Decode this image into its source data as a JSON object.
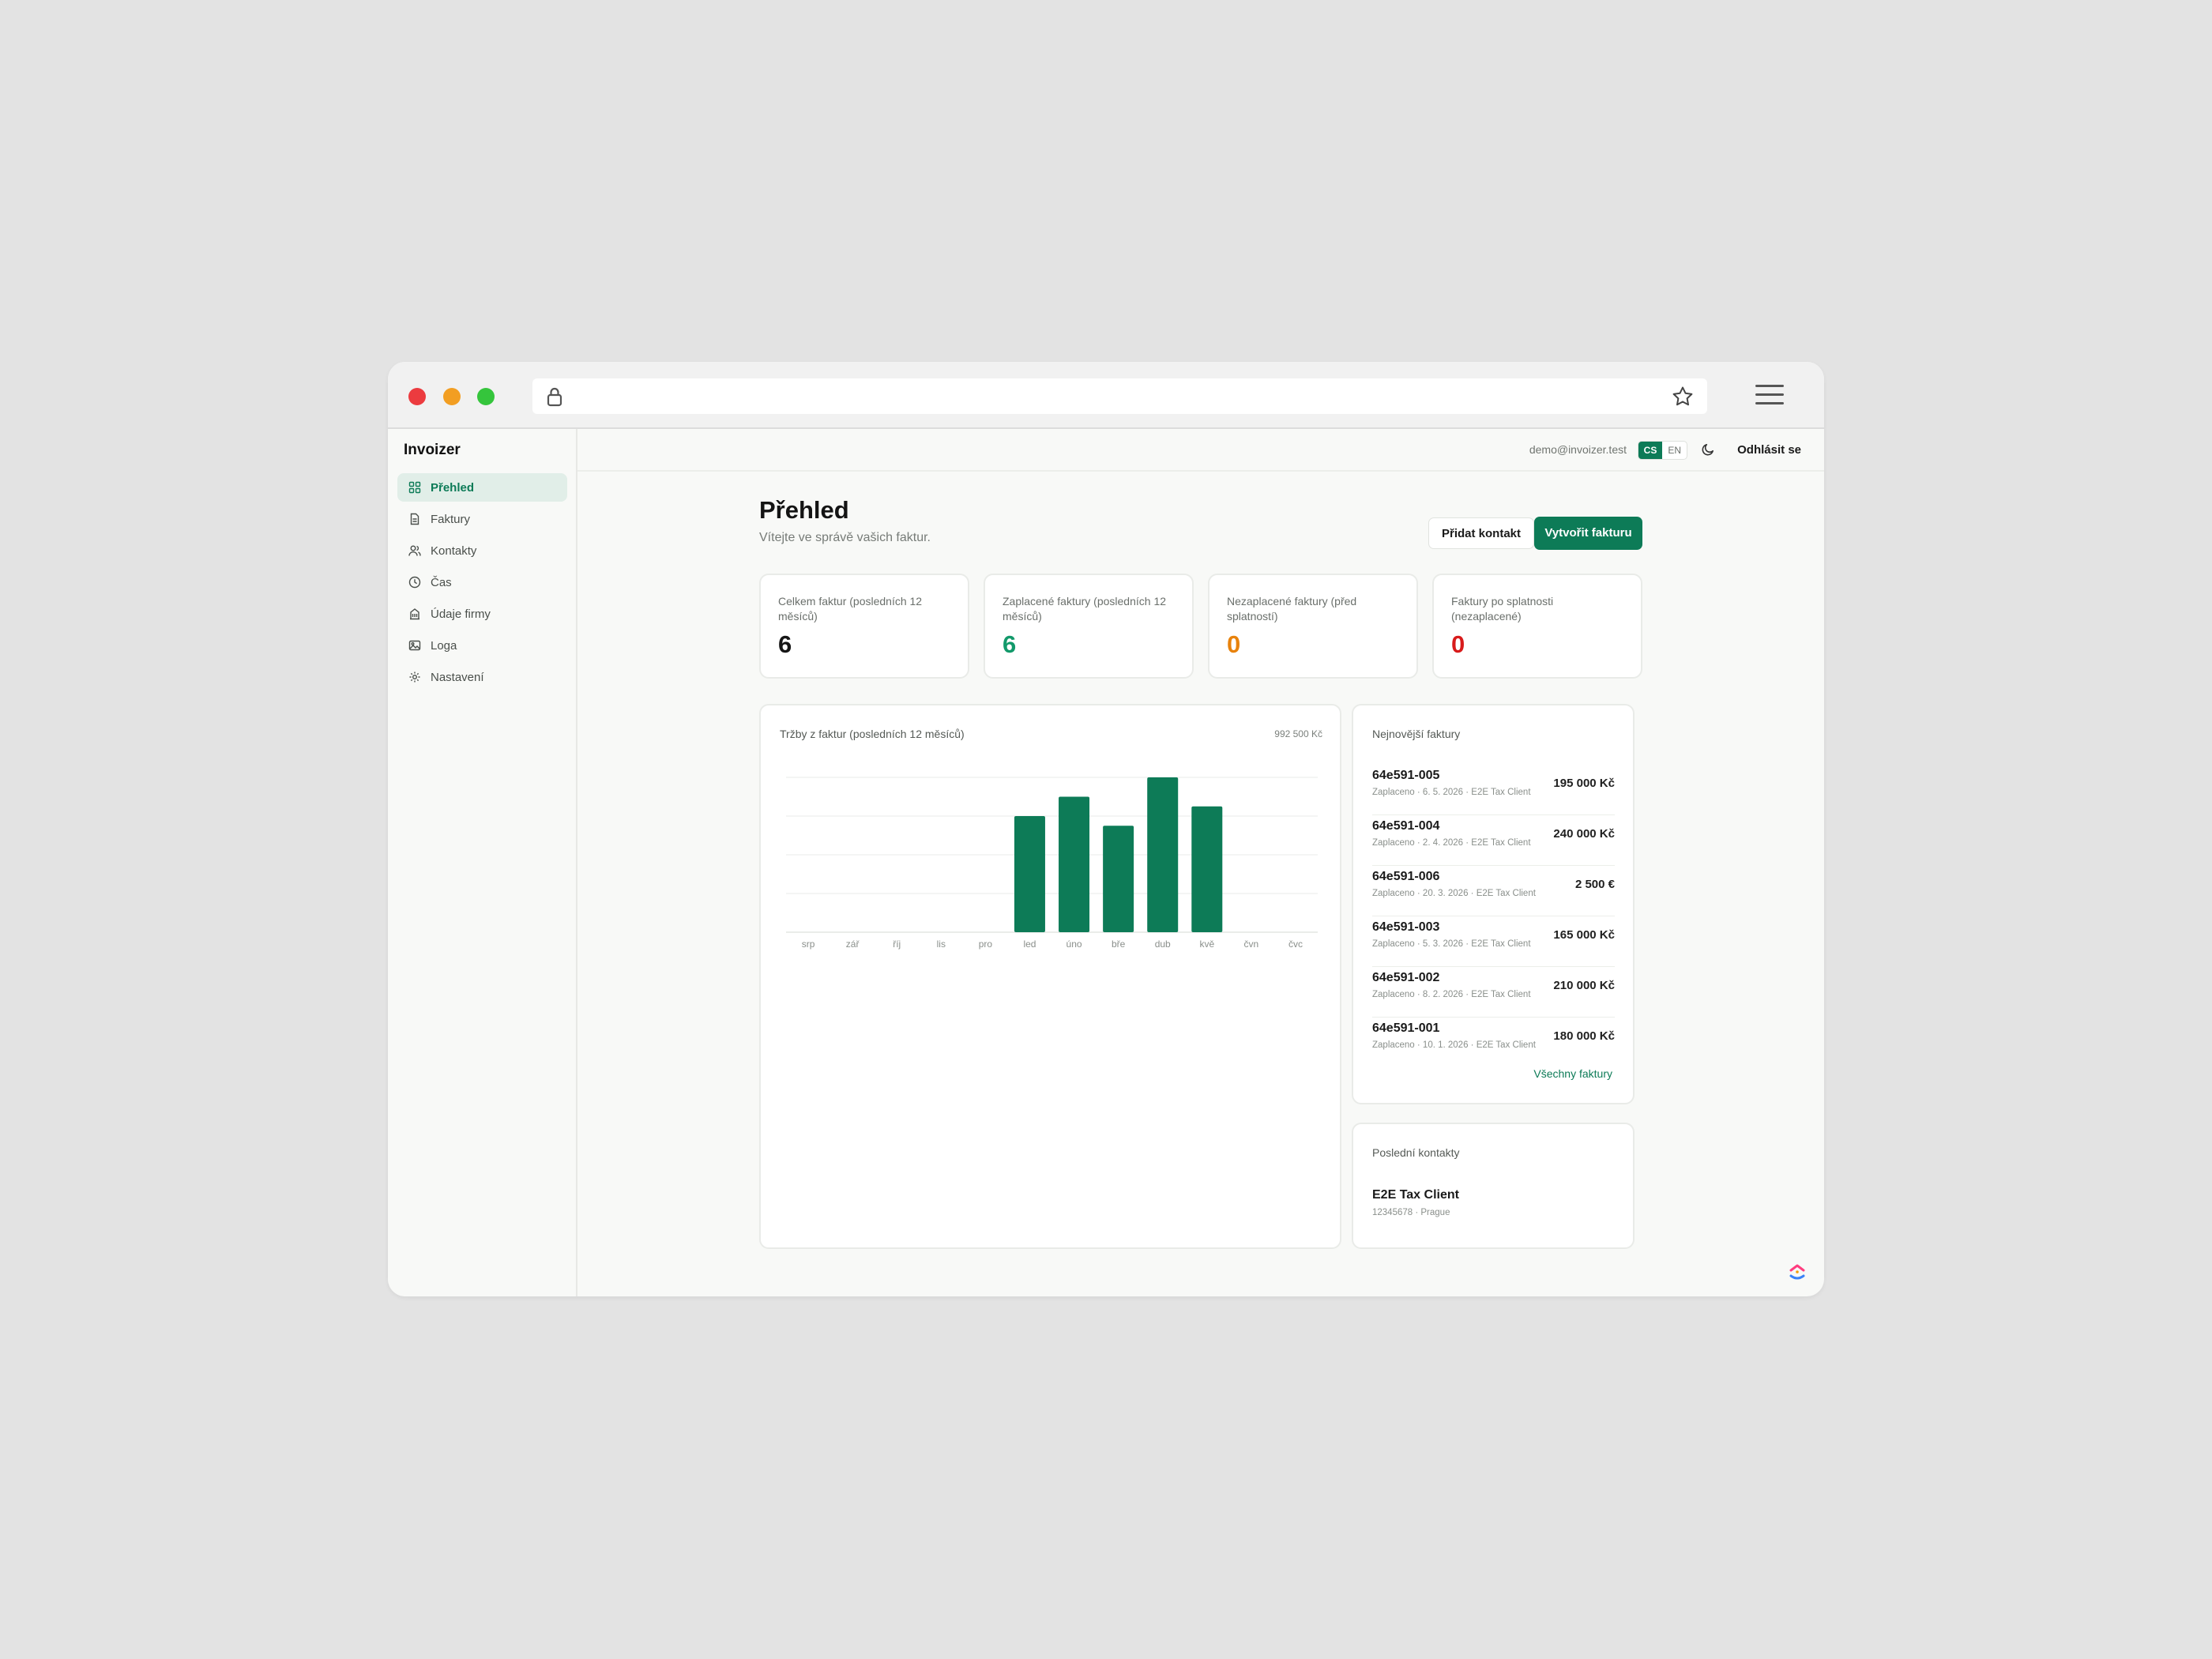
{
  "app": {
    "name": "Invoizer"
  },
  "colors": {
    "accent": "#0d7b57",
    "paid": "#12996a",
    "unpaid": "#e8820c",
    "overdue": "#d81b1b"
  },
  "sidebar": {
    "items": [
      {
        "label": "Přehled",
        "icon": "dashboard-icon",
        "active": true
      },
      {
        "label": "Faktury",
        "icon": "document-icon"
      },
      {
        "label": "Kontakty",
        "icon": "users-icon"
      },
      {
        "label": "Čas",
        "icon": "clock-icon"
      },
      {
        "label": "Údaje firmy",
        "icon": "building-icon"
      },
      {
        "label": "Loga",
        "icon": "image-icon"
      },
      {
        "label": "Nastavení",
        "icon": "gear-icon"
      }
    ]
  },
  "topbar": {
    "email": "demo@invoizer.test",
    "lang_cs": "CS",
    "lang_en": "EN",
    "logout_label": "Odhlásit se"
  },
  "page": {
    "title": "Přehled",
    "subtitle": "Vítejte ve správě vašich faktur.",
    "add_contact_label": "Přidat kontakt",
    "create_invoice_label": "Vytvořit fakturu"
  },
  "stats": [
    {
      "label": "Celkem faktur (posledních 12 měsíců)",
      "value": "6"
    },
    {
      "label": "Zaplacené faktury (posledních 12 měsíců)",
      "value": "6"
    },
    {
      "label": "Nezaplacené faktury (před splatností)",
      "value": "0"
    },
    {
      "label": "Faktury po splatnosti (nezaplacené)",
      "value": "0"
    }
  ],
  "chart_data": {
    "type": "bar",
    "title": "Tržby z faktur (posledních 12 měsíců)",
    "total_label": "992 500 Kč",
    "categories": [
      "srp",
      "zář",
      "říj",
      "lis",
      "pro",
      "led",
      "úno",
      "bře",
      "dub",
      "kvě",
      "čvn",
      "čvc"
    ],
    "values": [
      0,
      0,
      0,
      0,
      0,
      180000,
      210000,
      165000,
      240000,
      195000,
      0,
      0
    ],
    "ylim": [
      0,
      240000
    ],
    "grid": true
  },
  "recent_invoices": {
    "title": "Nejnovější faktury",
    "items": [
      {
        "number": "64e591-005",
        "meta": "Zaplaceno · 6. 5. 2026 · E2E Tax Client",
        "amount": "195 000 Kč"
      },
      {
        "number": "64e591-004",
        "meta": "Zaplaceno · 2. 4. 2026 · E2E Tax Client",
        "amount": "240 000 Kč"
      },
      {
        "number": "64e591-006",
        "meta": "Zaplaceno · 20. 3. 2026 · E2E Tax Client",
        "amount": "2 500 €"
      },
      {
        "number": "64e591-003",
        "meta": "Zaplaceno · 5. 3. 2026 · E2E Tax Client",
        "amount": "165 000 Kč"
      },
      {
        "number": "64e591-002",
        "meta": "Zaplaceno · 8. 2. 2026 · E2E Tax Client",
        "amount": "210 000 Kč"
      },
      {
        "number": "64e591-001",
        "meta": "Zaplaceno · 10. 1. 2026 · E2E Tax Client",
        "amount": "180 000 Kč"
      }
    ],
    "all_link": "Všechny faktury"
  },
  "recent_contacts": {
    "title": "Poslední kontakty",
    "items": [
      {
        "name": "E2E Tax Client",
        "meta": "12345678 · Prague"
      }
    ]
  }
}
